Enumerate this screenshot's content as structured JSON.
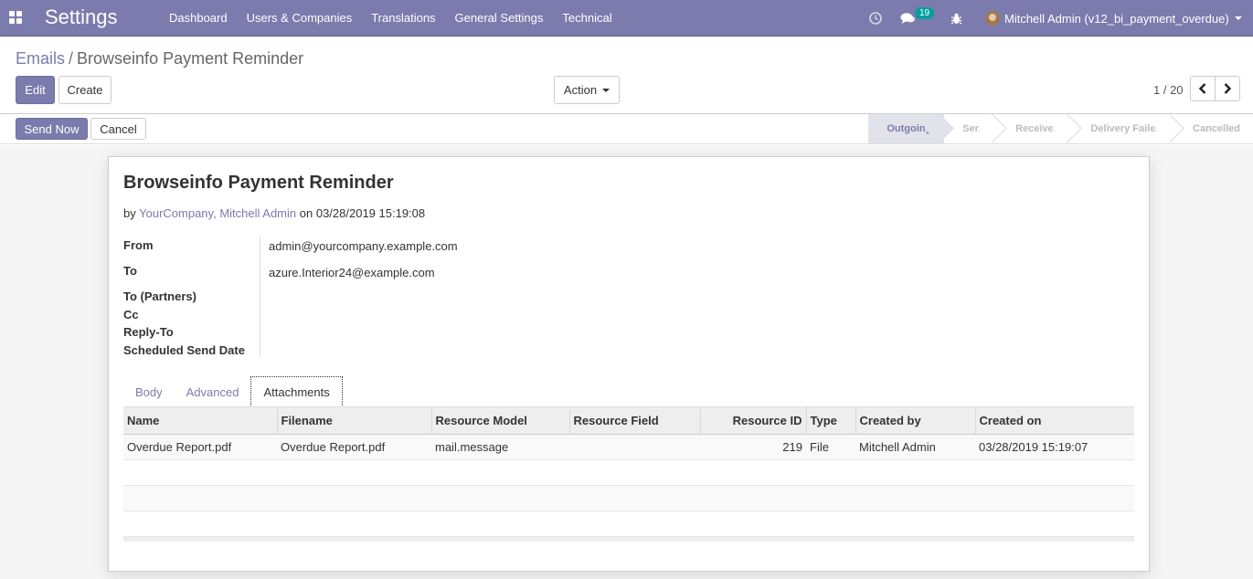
{
  "navbar": {
    "brand": "Settings",
    "menu": [
      "Dashboard",
      "Users & Companies",
      "Translations",
      "General Settings",
      "Technical"
    ],
    "chat_badge": "19",
    "user": "Mitchell Admin (v12_bi_payment_overdue)",
    "accent": "#7c7bad"
  },
  "breadcrumb": {
    "parent": "Emails",
    "separator": "/",
    "current": "Browseinfo Payment Reminder"
  },
  "buttons": {
    "edit": "Edit",
    "create": "Create",
    "action": "Action",
    "send_now": "Send Now",
    "cancel": "Cancel"
  },
  "pager": {
    "value": "1 / 20"
  },
  "stages": [
    {
      "label": "Outgoing",
      "active": true
    },
    {
      "label": "Sent",
      "active": false
    },
    {
      "label": "Received",
      "active": false
    },
    {
      "label": "Delivery Failed",
      "active": false
    },
    {
      "label": "Cancelled",
      "active": false
    }
  ],
  "record": {
    "title": "Browseinfo Payment Reminder",
    "by_prefix": "by",
    "by_company": "YourCompany,",
    "by_user": "Mitchell Admin",
    "on_word": "on",
    "date": "03/28/2019 15:19:08"
  },
  "fields": {
    "from_label": "From",
    "from_value": "admin@yourcompany.example.com",
    "to_label": "To",
    "to_value": "azure.Interior24@example.com",
    "to_partners_label": "To (Partners)",
    "cc_label": "Cc",
    "reply_to_label": "Reply-To",
    "scheduled_label": "Scheduled Send Date"
  },
  "tabs": [
    "Body",
    "Advanced",
    "Attachments"
  ],
  "attachments": {
    "columns": [
      "Name",
      "Filename",
      "Resource Model",
      "Resource Field",
      "Resource ID",
      "Type",
      "Created by",
      "Created on"
    ],
    "rows": [
      [
        "Overdue Report.pdf",
        "Overdue Report.pdf",
        "mail.message",
        "",
        "219",
        "File",
        "Mitchell Admin",
        "03/28/2019 15:19:07"
      ]
    ]
  }
}
